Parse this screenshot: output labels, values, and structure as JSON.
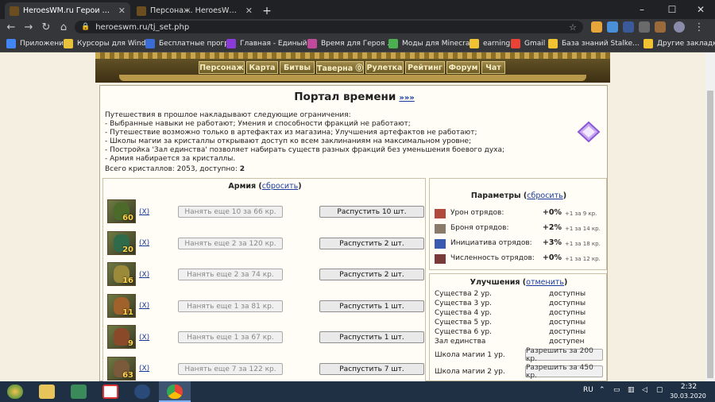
{
  "browser": {
    "tabs": [
      {
        "title": "HeroesWM.ru Герои войны и де"
      },
      {
        "title": "Персонаж. HeroesWM.ru Герои"
      }
    ],
    "new_tab": "+",
    "url": "heroeswm.ru/tj_set.php",
    "bookmarks": [
      {
        "label": "Приложения",
        "color": "#4285f4"
      },
      {
        "label": "Курсоры для Wind...",
        "color": "#e8c23a"
      },
      {
        "label": "Бесплатные прогр...",
        "color": "#3a6cd6"
      },
      {
        "label": "Главная - Единый...",
        "color": "#8a3ad6"
      },
      {
        "label": "Время для Героя ...",
        "color": "#c04a9a"
      },
      {
        "label": "Моды для Minecraf...",
        "color": "#4caf50"
      },
      {
        "label": "earning",
        "color": "#f1c232"
      },
      {
        "label": "Gmail",
        "color": "#ea4335"
      },
      {
        "label": "База знаний Stalke...",
        "color": "#f1c232"
      },
      {
        "label": "Другие закладки",
        "color": "#f1c232"
      }
    ]
  },
  "game_menu": [
    "Персонаж",
    "Карта",
    "Битвы",
    "Таверна ⓪",
    "Рулетка",
    "Рейтинг",
    "Форум",
    "Чат"
  ],
  "portal": {
    "title": "Портал времени",
    "title_link": "»»»",
    "intro_lines": [
      "Путешествия в прошлое накладывают следующие ограничения:",
      "- Выбранные навыки не работают; Умения и способности фракций не работают;",
      "- Путешествие возможно только в артефактах из магазина; Улучшения артефактов не работают;",
      "- Школы магии за кристаллы открывают доступ ко всем заклинаниям на максимальном уровне;",
      "- Постройка 'Зал единства' позволяет набирать существ разных фракций без уменьшения боевого духа;",
      "- Армия набирается за кристаллы."
    ],
    "crystals_text": "Всего кристаллов: 2053, доступно: ",
    "crystals_available": "2"
  },
  "army": {
    "title": "Армия",
    "reset": "сбросить",
    "units": [
      {
        "count": "60",
        "remove": "(X)",
        "hire": "Нанять еще 10 за 66 кр.",
        "dismiss": "Распустить 10 шт.",
        "color": "#4c6a2a"
      },
      {
        "count": "20",
        "remove": "(X)",
        "hire": "Нанять еще 2 за 120 кр.",
        "dismiss": "Распустить 2 шт.",
        "color": "#2f6a4a"
      },
      {
        "count": "16",
        "remove": "(X)",
        "hire": "Нанять еще 2 за 74 кр.",
        "dismiss": "Распустить 2 шт.",
        "color": "#9a8a3a"
      },
      {
        "count": "11",
        "remove": "(X)",
        "hire": "Нанять еще 1 за 81 кр.",
        "dismiss": "Распустить 1 шт.",
        "color": "#a0622a"
      },
      {
        "count": "9",
        "remove": "(X)",
        "hire": "Нанять еще 1 за 67 кр.",
        "dismiss": "Распустить 1 шт.",
        "color": "#8a4a2a"
      },
      {
        "count": "63",
        "remove": "(X)",
        "hire": "Нанять еще 7 за 122 кр.",
        "dismiss": "Распустить 7 шт.",
        "color": "#7a5a3a"
      }
    ]
  },
  "params": {
    "title": "Параметры",
    "reset": "сбросить",
    "rows": [
      {
        "label": "Урон отрядов:",
        "value": "+0%",
        "note": "+1 за 9 кр.",
        "icon": "sword-icon",
        "color": "#b04a3a"
      },
      {
        "label": "Броня отрядов:",
        "value": "+2%",
        "note": "+1 за 14 кр.",
        "icon": "armor-icon",
        "color": "#8a7a6a"
      },
      {
        "label": "Инициатива отрядов:",
        "value": "+3%",
        "note": "+1 за 18 кр.",
        "icon": "initiative-icon",
        "color": "#3a5ab0"
      },
      {
        "label": "Численность отрядов:",
        "value": "+0%",
        "note": "+1 за 12 кр.",
        "icon": "troops-icon",
        "color": "#7a3a3a"
      }
    ]
  },
  "upgrades": {
    "title": "Улучшения",
    "cancel": "отменить",
    "rows": [
      {
        "label": "Существа 2 ур.",
        "status": "доступны"
      },
      {
        "label": "Существа 3 ур.",
        "status": "доступны"
      },
      {
        "label": "Существа 4 ур.",
        "status": "доступны"
      },
      {
        "label": "Существа 5 ур.",
        "status": "доступны"
      },
      {
        "label": "Существа 6 ур.",
        "status": "доступны"
      },
      {
        "label": "Зал единства",
        "status": "доступен"
      }
    ],
    "schools": [
      {
        "label": "Школа магии 1 ур.",
        "button": "Разрешить за 200 кр."
      },
      {
        "label": "Школа магии 2 ур.",
        "button": "Разрешить за 450 кр."
      }
    ]
  },
  "taskbar": {
    "lang": "RU",
    "time": "2:32",
    "date": "30.03.2020"
  }
}
